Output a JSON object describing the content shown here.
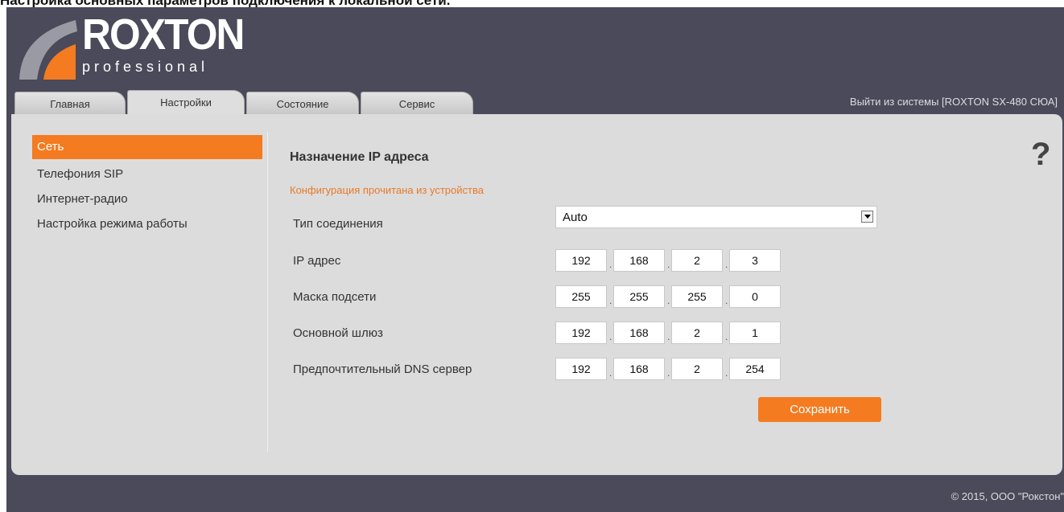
{
  "doc_caption": "Настройка основных параметров подключения к локальной сети.",
  "logo": {
    "word": "ROXTON",
    "sub": "professional"
  },
  "tabs": [
    {
      "label": "Главная"
    },
    {
      "label": "Настройки"
    },
    {
      "label": "Состояние"
    },
    {
      "label": "Сервис"
    }
  ],
  "logout": "Выйти из системы [ROXTON SX-480 СЮА]",
  "sidebar": {
    "items": [
      {
        "label": "Сеть"
      },
      {
        "label": "Телефония SIP"
      },
      {
        "label": "Интернет-радио"
      },
      {
        "label": "Настройка режима работы"
      }
    ]
  },
  "section": {
    "title": "Назначение IP адреса",
    "status": "Конфигурация прочитана из устройства"
  },
  "form": {
    "connection_type": {
      "label": "Тип соединения",
      "value": "Auto"
    },
    "ip": {
      "label": "IP адрес",
      "octets": [
        "192",
        "168",
        "2",
        "3"
      ]
    },
    "mask": {
      "label": "Маска подсети",
      "octets": [
        "255",
        "255",
        "255",
        "0"
      ]
    },
    "gateway": {
      "label": "Основной шлюз",
      "octets": [
        "192",
        "168",
        "2",
        "1"
      ]
    },
    "dns": {
      "label": "Предпочтительный DNS сервер",
      "octets": [
        "192",
        "168",
        "2",
        "254"
      ]
    },
    "save_label": "Сохранить",
    "dot": "."
  },
  "help_glyph": "?",
  "footer": "© 2015, ООО \"Рокстон\"",
  "colors": {
    "accent": "#f47b20",
    "frame": "#4a4a5a",
    "panel": "#dcdcdc"
  }
}
